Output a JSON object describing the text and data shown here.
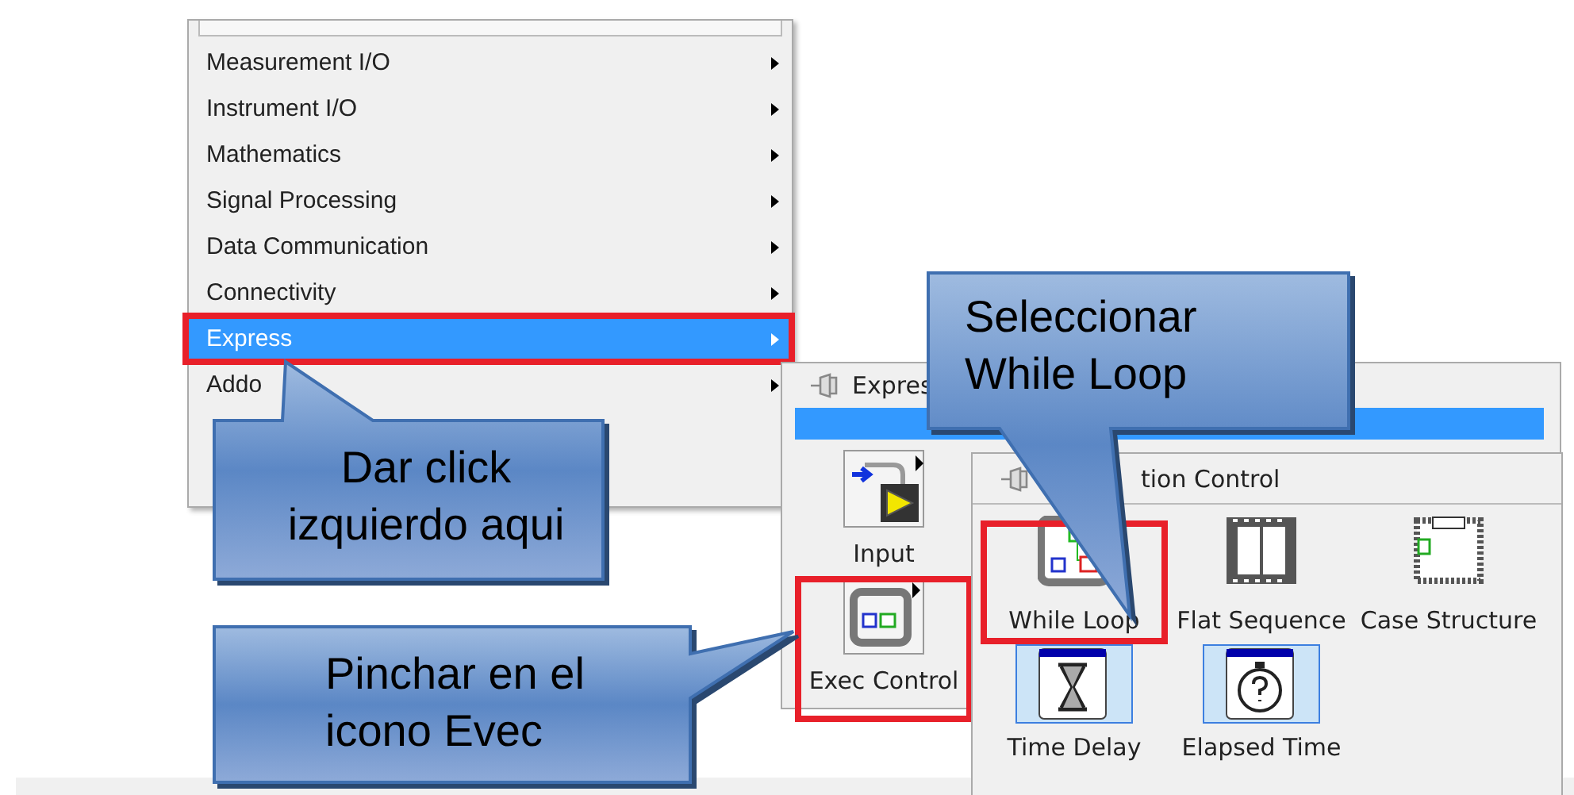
{
  "menu": {
    "items": [
      {
        "label": "Measurement I/O",
        "selected": false,
        "submenu": true,
        "framed": false
      },
      {
        "label": "Instrument I/O",
        "selected": false,
        "submenu": true,
        "framed": false
      },
      {
        "label": "Mathematics",
        "selected": false,
        "submenu": true,
        "framed": false
      },
      {
        "label": "Signal Processing",
        "selected": false,
        "submenu": true,
        "framed": false
      },
      {
        "label": "Data Communication",
        "selected": false,
        "submenu": true,
        "framed": false
      },
      {
        "label": "Connectivity",
        "selected": false,
        "submenu": true,
        "framed": false
      },
      {
        "label": "Express",
        "selected": true,
        "submenu": true,
        "framed": true
      },
      {
        "label": "Addo",
        "selected": false,
        "submenu": true,
        "framed": false
      }
    ]
  },
  "express_palette": {
    "title": "Expres",
    "items": [
      {
        "label": "Input",
        "kind": "input",
        "framed": false
      },
      {
        "label": "Exec Control",
        "kind": "exec_control",
        "framed": true
      }
    ]
  },
  "execution_palette": {
    "title": "tion Control",
    "items": [
      {
        "label": "While Loop",
        "kind": "while_loop",
        "framed": true,
        "highlighted": false
      },
      {
        "label": "Flat Sequence",
        "kind": "flat_sequence",
        "framed": false,
        "highlighted": false
      },
      {
        "label": "Case Structure",
        "kind": "case_structure",
        "framed": false,
        "highlighted": false
      },
      {
        "label": "Time Delay",
        "kind": "time_delay",
        "framed": false,
        "highlighted": true
      },
      {
        "label": "Elapsed Time",
        "kind": "elapsed_time",
        "framed": false,
        "highlighted": true
      }
    ]
  },
  "callouts": [
    {
      "text": "Seleccionar While Loop"
    },
    {
      "text": "Dar click izquierdo aqui"
    },
    {
      "text": "Pinchar en el icono Evec"
    }
  ]
}
